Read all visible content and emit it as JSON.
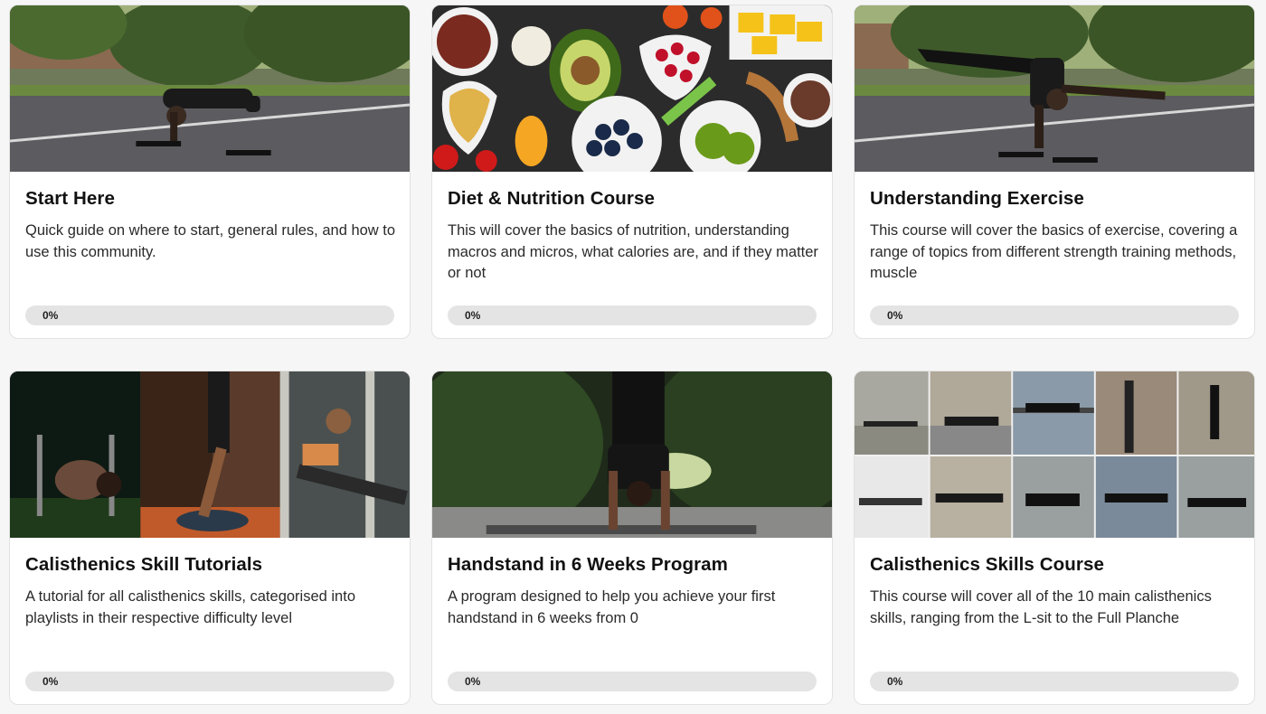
{
  "courses": [
    {
      "title": "Start Here",
      "description": "Quick guide on where to start, general rules, and how to use this community.",
      "progress": 0,
      "progress_label": "0%",
      "image_icon": "pushup-photo"
    },
    {
      "title": "Diet & Nutrition Course",
      "description": "This will cover the basics of nutrition, understanding macros and micros, what calories are, and if they matter or not",
      "progress": 0,
      "progress_label": "0%",
      "image_icon": "food-photo"
    },
    {
      "title": "Understanding Exercise",
      "description": "This course will cover the basics of exercise, covering a range of topics from different strength training methods, muscle",
      "progress": 0,
      "progress_label": "0%",
      "image_icon": "one-arm-planche-photo"
    },
    {
      "title": "Calisthenics Skill Tutorials",
      "description": "A tutorial for all calisthenics skills, categorised into playlists in their respective difficulty level",
      "progress": 0,
      "progress_label": "0%",
      "image_icon": "skills-collage-photo"
    },
    {
      "title": "Handstand in 6 Weeks Program",
      "description": "A program designed to help you achieve your first handstand in 6 weeks from 0",
      "progress": 0,
      "progress_label": "0%",
      "image_icon": "handstand-photo"
    },
    {
      "title": "Calisthenics Skills Course",
      "description": "This course will cover all of the 10 main calisthenics skills, ranging from the L-sit to the Full Planche",
      "progress": 0,
      "progress_label": "0%",
      "image_icon": "skills-grid-photo"
    }
  ],
  "colors": {
    "page_background": "#f6f6f6",
    "card_background": "#ffffff",
    "progress_track": "#e4e4e4",
    "progress_fill": "#4b8df8"
  }
}
